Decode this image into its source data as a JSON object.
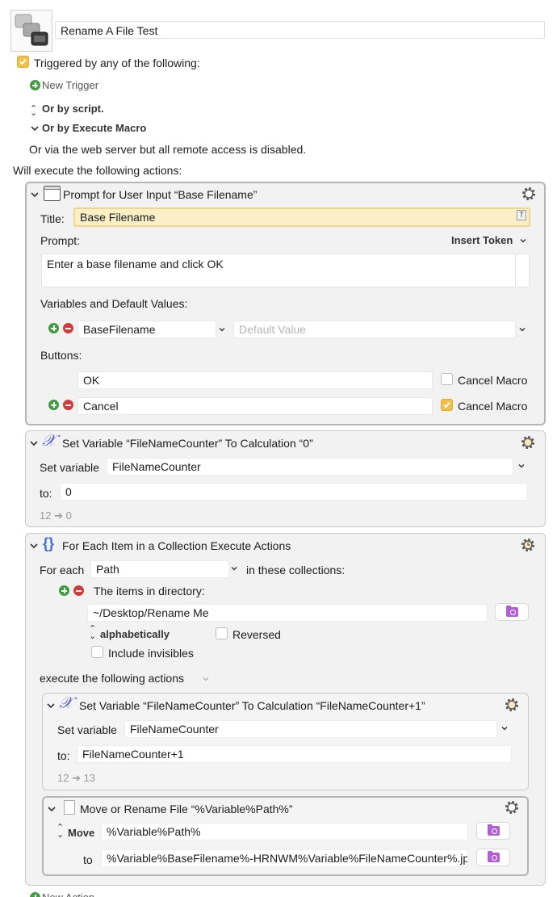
{
  "macro": {
    "name": "Rename A File Test",
    "triggered_label": "Triggered by any of the following:",
    "new_trigger": "New Trigger",
    "or_by_script": "Or by script.",
    "or_by_execute_macro": "Or by Execute Macro",
    "web_server_note": "Or via the web server but all remote access is disabled.",
    "will_execute": "Will execute the following actions:"
  },
  "prompt_action": {
    "title": "Prompt for User Input “Base Filename”",
    "title_label": "Title:",
    "title_value": "Base Filename",
    "token_badge": "T",
    "prompt_label": "Prompt:",
    "insert_token": "Insert Token",
    "prompt_text": "Enter a base filename and click OK",
    "vars_label": "Variables and Default Values:",
    "variable_name": "BaseFilename",
    "default_placeholder": "Default Value",
    "buttons_label": "Buttons:",
    "buttons": [
      {
        "label": "OK",
        "cancel_macro_label": "Cancel Macro",
        "cancel_checked": false
      },
      {
        "label": "Cancel",
        "cancel_macro_label": "Cancel Macro",
        "cancel_checked": true
      }
    ]
  },
  "set_var_action": {
    "title": "Set Variable “FileNameCounter” To Calculation “0”",
    "set_label": "Set variable",
    "variable": "FileNameCounter",
    "to_label": "to:",
    "value": "0",
    "preview": "12 ➔ 0"
  },
  "for_each_action": {
    "title": "For Each Item in a Collection Execute Actions",
    "for_each_label": "For each",
    "variable": "Path",
    "in_collections": "in these collections:",
    "collection_label": "The items in directory:",
    "directory": "~/Desktop/Rename Me",
    "sort": "alphabetically",
    "reversed_label": "Reversed",
    "invisibles_label": "Include invisibles",
    "execute_label": "execute the following actions",
    "inner_set": {
      "title": "Set Variable “FileNameCounter” To Calculation “FileNameCounter+1”",
      "set_label": "Set variable",
      "variable": "FileNameCounter",
      "to_label": "to:",
      "value": "FileNameCounter+1",
      "preview": "12 ➔ 13"
    },
    "inner_move": {
      "title": "Move or Rename File “%Variable%Path%”",
      "mode": "Move",
      "source": "%Variable%Path%",
      "to_label": "to",
      "destination": "%Variable%BaseFilename%-HRNWM%Variable%FileNameCounter%.jpg"
    }
  },
  "footer": {
    "new_action": "New Action"
  }
}
